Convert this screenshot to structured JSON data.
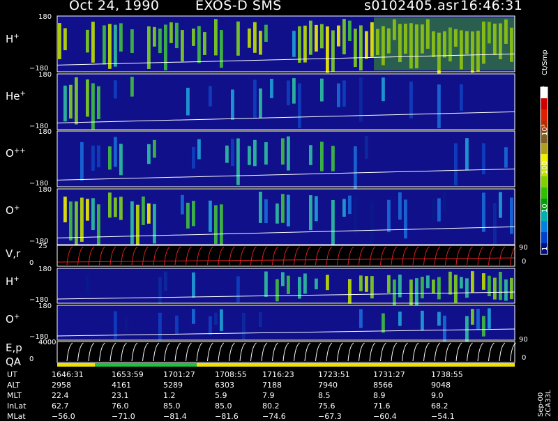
{
  "header": {
    "date": "Oct 24, 1990",
    "instrument": "EXOS-D SMS",
    "file": "s0102405.asr",
    "time": "16:46:31"
  },
  "colorbar": {
    "unit": "Ct/Smp",
    "ticks": [
      "10⁴",
      "10³",
      "100",
      "10",
      "1"
    ],
    "colors": [
      "#ffffff",
      "#d00000",
      "#e02000",
      "#b03000",
      "#806020",
      "#b0a020",
      "#f0f000",
      "#c0e000",
      "#80d000",
      "#30c000",
      "#00a000",
      "#00b0b0",
      "#0080e0",
      "#0040d0",
      "#001080"
    ]
  },
  "panels": [
    {
      "id": "hplus-1",
      "label": "H",
      "sup": "+",
      "ytop": "180",
      "ybot": "−180"
    },
    {
      "id": "heplus",
      "label": "He",
      "sup": "+",
      "ytop": "180",
      "ybot": "−180"
    },
    {
      "id": "oplusplus",
      "label": "O",
      "sup": "++",
      "ytop": "180",
      "ybot": "−180"
    },
    {
      "id": "oplus-1",
      "label": "O",
      "sup": "+",
      "ytop": "180",
      "ybot": "−180"
    },
    {
      "id": "vr",
      "label": "V,r",
      "sup": "",
      "ytop": "25",
      "ybot": "0",
      "right_top": "90",
      "right_bot": "0"
    },
    {
      "id": "hplus-2",
      "label": "H",
      "sup": "+",
      "ytop": "180",
      "ybot": "−180"
    },
    {
      "id": "oplus-2",
      "label": "O",
      "sup": "+",
      "ytop": "180",
      "ybot": "−180"
    },
    {
      "id": "ep",
      "label": "E,p",
      "sup": "",
      "ytop": "4000",
      "ybot": "0",
      "right_top": "90",
      "right_bot": "0"
    }
  ],
  "qa_label": "QA",
  "side_text": "Sep-00  2CA33L",
  "chart_data": {
    "type": "heatmap",
    "title": "Oct 24, 1990   EXOS-D SMS",
    "x_axis_rows": [
      {
        "name": "UT",
        "values": [
          "1646:31",
          "1653:59",
          "1701:27",
          "1708:55",
          "1716:23",
          "1723:51",
          "1731:27",
          "1738:55"
        ]
      },
      {
        "name": "ALT",
        "values": [
          "2958",
          "4161",
          "5289",
          "6303",
          "7188",
          "7940",
          "8566",
          "9048"
        ]
      },
      {
        "name": "MLT",
        "values": [
          "22.4",
          "23.1",
          "1.2",
          "5.9",
          "7.9",
          "8.5",
          "8.9",
          "9.0"
        ]
      },
      {
        "name": "InLat",
        "values": [
          "62.7",
          "76.0",
          "85.0",
          "85.0",
          "80.2",
          "75.6",
          "71.6",
          "68.2"
        ]
      },
      {
        "name": "MLat",
        "values": [
          "−56.0",
          "−71.0",
          "−81.4",
          "−81.6",
          "−74.6",
          "−67.3",
          "−60.4",
          "−54.1"
        ]
      }
    ]
  }
}
